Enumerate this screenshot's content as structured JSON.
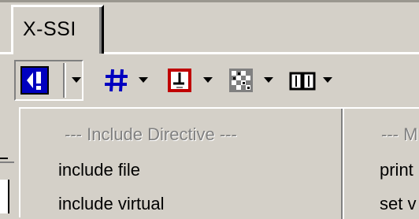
{
  "tab": {
    "label": "X-SSI"
  },
  "toolbar": {
    "buttons": [
      {
        "name": "include-directive-button",
        "icon": "ssi-include-icon",
        "pressed": true
      },
      {
        "name": "echo-button",
        "icon": "hash-icon"
      },
      {
        "name": "exec-button",
        "icon": "page-exec-icon"
      },
      {
        "name": "config-button",
        "icon": "config-grid-icon"
      },
      {
        "name": "reference-button",
        "icon": "book-icon"
      }
    ]
  },
  "panel": {
    "columns": [
      {
        "header": "--- Include Directive ---",
        "items": [
          "include file",
          "include virtual"
        ]
      },
      {
        "header": "--- M",
        "items": [
          "print",
          "set v"
        ]
      }
    ]
  },
  "colors": {
    "face": "#d4d0c8",
    "shadow": "#808080",
    "highlight": "#ffffff",
    "icon_blue": "#0000c0",
    "icon_red": "#c00000"
  }
}
